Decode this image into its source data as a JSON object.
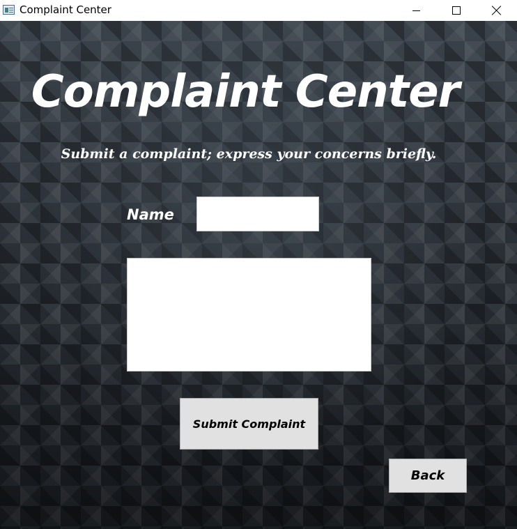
{
  "window": {
    "title": "Complaint Center",
    "icon": "app-window-icon",
    "controls": {
      "minimize": "minimize-icon",
      "maximize": "maximize-icon",
      "close": "close-icon"
    }
  },
  "main": {
    "heading": "Complaint Center",
    "subheading": "Submit a complaint; express your concerns briefly.",
    "name_label": "Name",
    "name_value": "",
    "complaint_value": ""
  },
  "buttons": {
    "submit_label": "Submit Complaint",
    "back_label": "Back"
  },
  "colors": {
    "background": "#2b3138",
    "text": "#ffffff",
    "button": "#e1e1e1",
    "input": "#ffffff"
  }
}
